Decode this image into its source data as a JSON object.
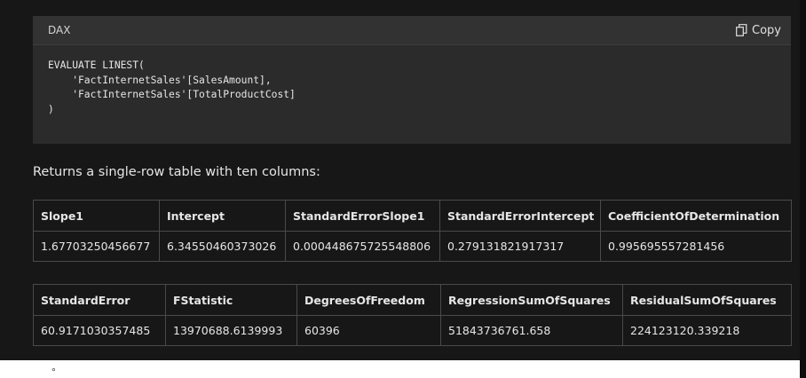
{
  "code_block": {
    "language": "DAX",
    "copy_label": "Copy",
    "code": "EVALUATE LINEST(\n    'FactInternetSales'[SalesAmount],\n    'FactInternetSales'[TotalProductCost]\n)"
  },
  "description": "Returns a single-row table with ten columns:",
  "table1": {
    "headers": [
      "Slope1",
      "Intercept",
      "StandardErrorSlope1",
      "StandardErrorIntercept",
      "CoefficientOfDetermination"
    ],
    "rows": [
      [
        "1.67703250456677",
        "6.34550460373026",
        "0.000448675725548806",
        "0.279131821917317",
        "0.995695557281456"
      ]
    ]
  },
  "table2": {
    "headers": [
      "StandardError",
      "FStatistic",
      "DegreesOfFreedom",
      "RegressionSumOfSquares",
      "ResidualSumOfSquares"
    ],
    "rows": [
      [
        "60.9171030357485",
        "13970688.6139993",
        "60396",
        "51843736761.658",
        "224123120.339218"
      ]
    ]
  },
  "colors": {
    "page_background": "#171717",
    "code_background": "#2b2b2b",
    "code_header_background": "#323232",
    "text": "#e6e6e6",
    "border": "#4a4a4a"
  },
  "icons": {
    "copy": "copy-icon"
  }
}
